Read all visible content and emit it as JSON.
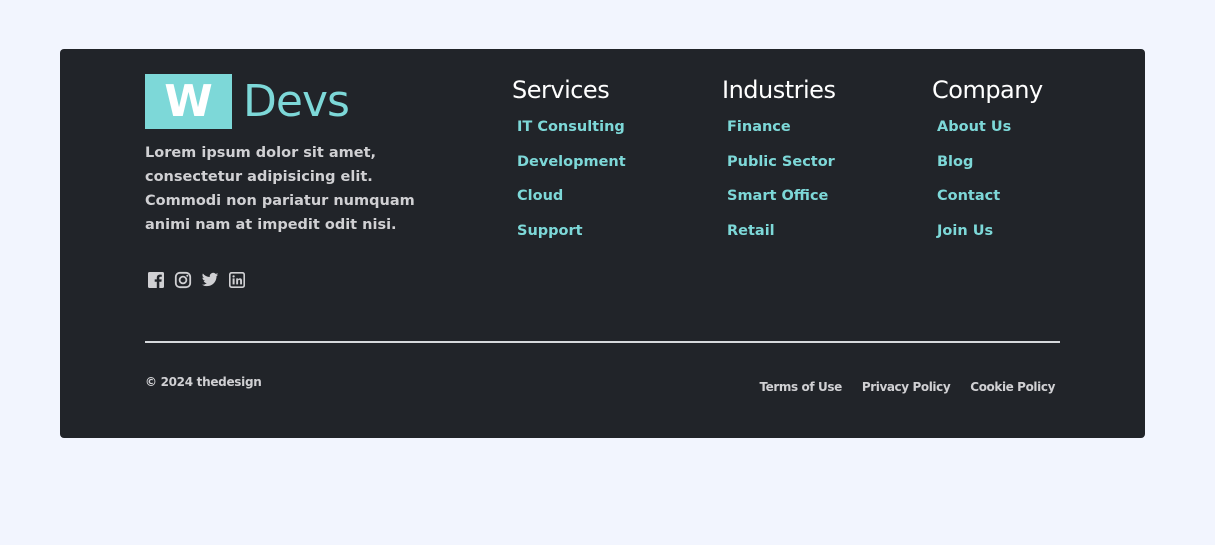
{
  "brand": {
    "logo_letter": "W",
    "logo_text": "Devs",
    "description": "Lorem ipsum dolor sit amet, consectetur adipisicing elit. Commodi non pariatur numquam animi nam at impedit odit nisi.",
    "accent_color": "#7dd8d8"
  },
  "social": [
    {
      "name": "facebook-icon"
    },
    {
      "name": "instagram-icon"
    },
    {
      "name": "twitter-icon"
    },
    {
      "name": "linkedin-icon"
    }
  ],
  "columns": {
    "services": {
      "title": "Services",
      "links": [
        "IT Consulting",
        "Development",
        "Cloud",
        "Support"
      ]
    },
    "industries": {
      "title": "Industries",
      "links": [
        "Finance",
        "Public Sector",
        "Smart Office",
        "Retail"
      ]
    },
    "company": {
      "title": "Company",
      "links": [
        "About Us",
        "Blog",
        "Contact",
        "Join Us"
      ]
    }
  },
  "bottom": {
    "copyright": "© 2024 thedesign",
    "legal_links": [
      "Terms of Use",
      "Privacy Policy",
      "Cookie Policy"
    ]
  },
  "colors": {
    "page_background": "#f2f5fe",
    "footer_background": "#212429",
    "link": "#7dd8d8",
    "muted_text": "#d0d0d3"
  }
}
